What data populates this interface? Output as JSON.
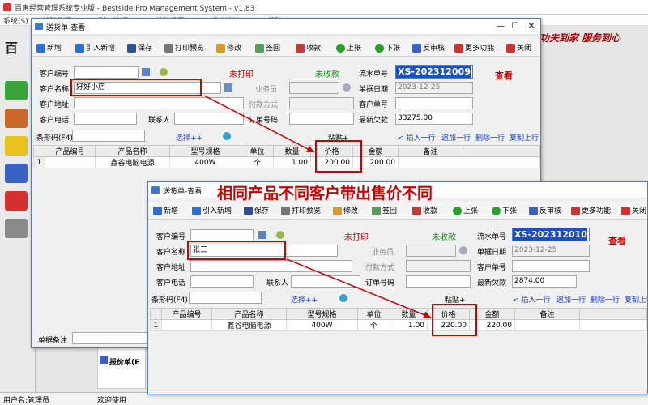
{
  "app": {
    "title": "百惠经营管理系统专业版 - Bestside Pro Management System - v1.83",
    "menu": [
      "系统(S)",
      "基础数据(J)",
      "财务管理(C)",
      "基础设置(B)",
      "系统维护(M)",
      "帮助(H)"
    ],
    "sidebar_partial": "百",
    "slogan": "功夫到家 服务到心",
    "status_user": "用户名:管理员",
    "status_welcome": "欢迎使用",
    "bottom_partial_text": "报价单(E",
    "remark_label": "单据备注"
  },
  "toolbar": {
    "new": "新增",
    "import": "引入新增",
    "save": "保存",
    "print": "打印预览",
    "edit": "修改",
    "sign": "签回",
    "receive": "收款",
    "prev": "上张",
    "next": "下张",
    "unapprove": "反审核",
    "more": "更多功能",
    "close": "关闭"
  },
  "labels": {
    "cust_code": "客户编号",
    "cust_name": "客户名称",
    "cust_addr": "客户地址",
    "cust_phone": "客户电话",
    "contact": "联系人",
    "salesman": "业务员",
    "pay_method": "付款方式",
    "order_no": "订单号码",
    "serial_no": "流水单号",
    "doc_date": "单据日期",
    "cust_order": "客户单号",
    "latest_owed": "最新欠款",
    "barcode": "条形码(F4)",
    "select": "选择++",
    "paste": "粘贴+",
    "insert_row": "插入一行",
    "append_row": "追加一行",
    "delete_row": "删除一行",
    "copy_row": "复制上行",
    "view_mode": "查看",
    "status_unprinted": "未打印",
    "status_unpaid": "未收款"
  },
  "columns": [
    "产品编号",
    "产品名称",
    "型号规格",
    "单位",
    "数量",
    "价格",
    "金额",
    "备注"
  ],
  "window1": {
    "title": "送货单-查看",
    "cust_name": "好好小店",
    "doc_no": "XS-202312009",
    "date": "2023-12-25",
    "owed": "33275.00",
    "row": {
      "idx": "1",
      "code": "",
      "name": "鑫谷电脑电源",
      "spec": "400W",
      "unit": "个",
      "qty": "1.00",
      "price": "200.00",
      "amount": "200.00",
      "note": ""
    }
  },
  "window2": {
    "title": "送货单-查看",
    "cust_name": "张三",
    "doc_no": "XS-202312010",
    "date": "2023-12-25",
    "owed": "2874.00",
    "row": {
      "idx": "1",
      "code": "",
      "name": "鑫谷电脑电源",
      "spec": "400W",
      "unit": "个",
      "qty": "1.00",
      "price": "220.00",
      "amount": "220.00",
      "note": ""
    }
  },
  "annotation": "相同产品不同客户带出售价不同",
  "colors": {
    "accent_red": "#d00000",
    "title_blue": "#1b3fbf",
    "unpaid_green": "#1a8a1a"
  }
}
